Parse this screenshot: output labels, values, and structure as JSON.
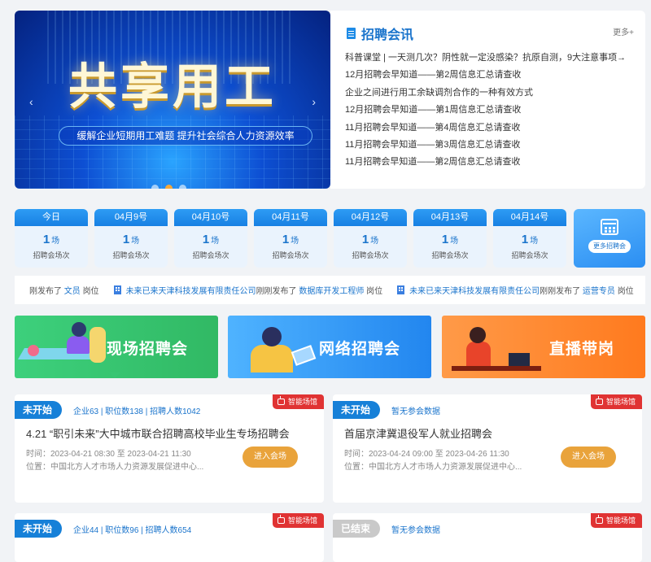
{
  "banner": {
    "title": "共享用工",
    "subtitle": "缓解企业短期用工难题   提升社会综合人力资源效率",
    "prev": "‹",
    "next": "›"
  },
  "news": {
    "title": "招聘会讯",
    "more": "更多+",
    "items": [
      "科普课堂 | 一天测几次？阴性就一定没感染？抗原自测，9大注意事项→",
      "12月招聘会早知道——第2周信息汇总请查收",
      "企业之间进行用工余缺调剂合作的一种有效方式",
      "12月招聘会早知道——第1周信息汇总请查收",
      "11月招聘会早知道——第4周信息汇总请查收",
      "11月招聘会早知道——第3周信息汇总请查收",
      "11月招聘会早知道——第2周信息汇总请查收"
    ]
  },
  "dates": [
    {
      "label": "今日",
      "count": "1",
      "unit": "场",
      "desc": "招聘会场次"
    },
    {
      "label": "04月9号",
      "count": "1",
      "unit": "场",
      "desc": "招聘会场次"
    },
    {
      "label": "04月10号",
      "count": "1",
      "unit": "场",
      "desc": "招聘会场次"
    },
    {
      "label": "04月11号",
      "count": "1",
      "unit": "场",
      "desc": "招聘会场次"
    },
    {
      "label": "04月12号",
      "count": "1",
      "unit": "场",
      "desc": "招聘会场次"
    },
    {
      "label": "04月13号",
      "count": "1",
      "unit": "场",
      "desc": "招聘会场次"
    },
    {
      "label": "04月14号",
      "count": "1",
      "unit": "场",
      "desc": "招聘会场次"
    }
  ],
  "more_fairs": "更多招聘会",
  "ticker": {
    "lead": "刚发布了",
    "lead_job": "文员",
    "pos": "岗位",
    "just_posted": "刚刚发布了",
    "items": [
      {
        "company": "未来已来天津科技发展有限责任公司",
        "job": "数据库开发工程师"
      },
      {
        "company": "未来已来天津科技发展有限责任公司",
        "job": "运营专员"
      }
    ]
  },
  "categories": {
    "onsite": "现场招聘会",
    "online": "网络招聘会",
    "live": "直播带岗"
  },
  "fairs": [
    {
      "status": "未开始",
      "stats": "企业63 | 职位数138 | 招聘人数1042",
      "tag": "智能场馆",
      "title": "4.21 “职引未来”大中城市联合招聘高校毕业生专场招聘会",
      "time": "时间：2023-04-21 08:30 至 2023-04-21 11:30",
      "place": "位置：中国北方人才市场人力资源发展促进中心...",
      "button": "进入会场"
    },
    {
      "status": "未开始",
      "stats": "暂无参会数据",
      "tag": "智能场馆",
      "title": "首届京津冀退役军人就业招聘会",
      "time": "时间：2023-04-24 09:00 至 2023-04-26 11:30",
      "place": "位置：中国北方人才市场人力资源发展促进中心...",
      "button": "进入会场"
    },
    {
      "status": "未开始",
      "stats": "企业44 | 职位数96 | 招聘人数654",
      "tag": "智能场馆"
    },
    {
      "status": "已结束",
      "stats": "暂无参会数据",
      "tag": "智能场馆"
    }
  ],
  "colors": {
    "brand_blue": "#1680d8",
    "onsite_green": "#31b964",
    "online_blue": "#2286ef",
    "live_orange": "#ff7a1e",
    "smart_red": "#e03333",
    "enter_gold": "#e9a33b"
  }
}
